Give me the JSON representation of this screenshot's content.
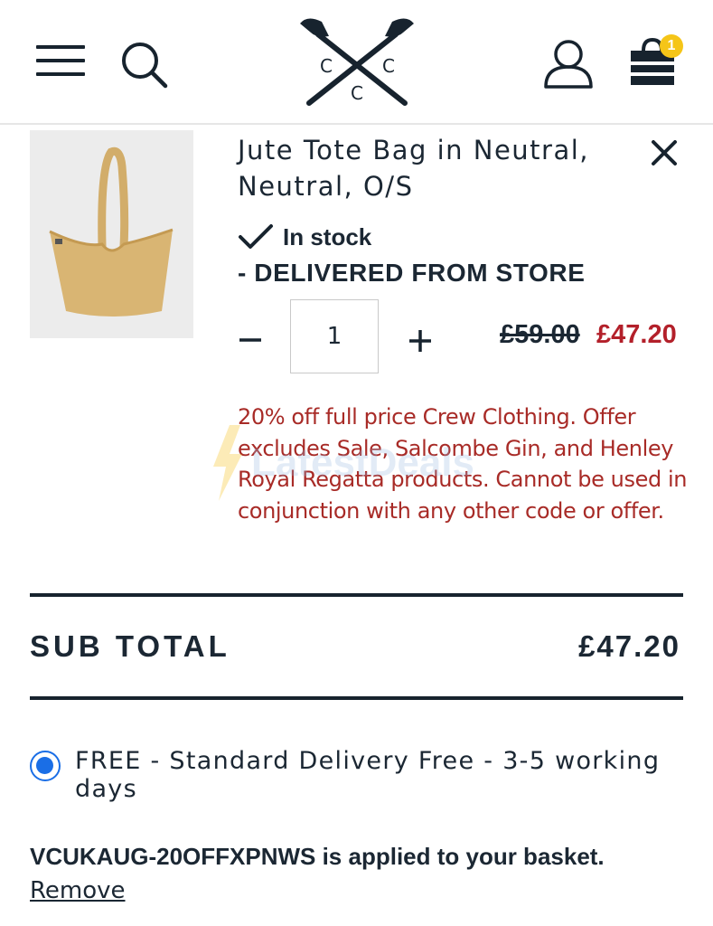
{
  "header": {
    "menu_icon": "hamburger-menu-icon",
    "search_icon": "search-icon",
    "logo_letters": [
      "C",
      "C",
      "C"
    ],
    "account_icon": "user-account-icon",
    "bag_icon": "shopping-bag-icon",
    "bag_count": "1",
    "bag_badge_color": "#f5c518"
  },
  "item": {
    "name": "Jute Tote Bag in Neutral, Neutral, O/S",
    "remove_icon": "close-icon",
    "stock_icon": "checkmark-icon",
    "stock_status": "In stock",
    "delivery_note": "- DELIVERED FROM STORE",
    "quantity": "1",
    "price_original": "£59.00",
    "price_sale": "£47.20",
    "sale_color": "#b3202a",
    "offer_text": "20% off full price Crew Clothing. Offer excludes Sale, Salcombe Gin, and Henley Royal Regatta products. Cannot be used in conjunction with any other code or offer."
  },
  "summary": {
    "subtotal_label": "SUB TOTAL",
    "subtotal_value": "£47.20"
  },
  "delivery": {
    "option_label": "FREE - Standard Delivery Free - 3-5 working days",
    "selected": true,
    "radio_color": "#1a6ee6"
  },
  "promo": {
    "code": "VCUKAUG-20OFFXPNWS",
    "applied_text": " is applied to your basket.",
    "remove_label": "Remove"
  },
  "watermark": {
    "text": "LatestDeals"
  }
}
